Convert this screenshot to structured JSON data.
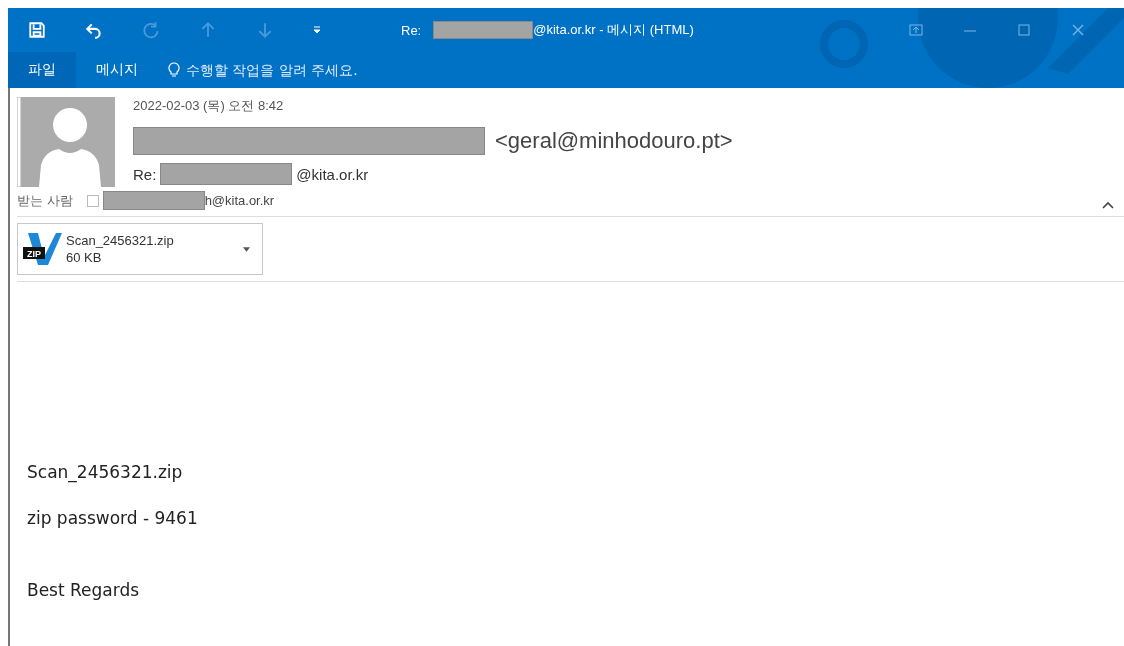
{
  "window": {
    "title_prefix": "Re:",
    "title_suffix": "@kita.or.kr - 메시지 (HTML)"
  },
  "ribbon_tabs": [
    {
      "label": "파일",
      "selected": true
    },
    {
      "label": "메시지",
      "selected": false
    }
  ],
  "tell_me": {
    "placeholder": "수행할 작업을 알려 주세요."
  },
  "header": {
    "date": "2022-02-03 (목) 오전 8:42",
    "sender_email": "<geral@minhodouro.pt>",
    "subject_prefix": "Re:",
    "subject_suffix": "@kita.or.kr",
    "to_label": "받는 사람",
    "recipient_checked": false,
    "to_suffix": "h@kita.or.kr",
    "expanded": true
  },
  "attachment": {
    "name": "Scan_2456321.zip",
    "size": "60 KB",
    "icon_label": "ZIP"
  },
  "body": [
    "Scan_2456321.zip",
    "zip password - 9461",
    "Best Regards"
  ]
}
